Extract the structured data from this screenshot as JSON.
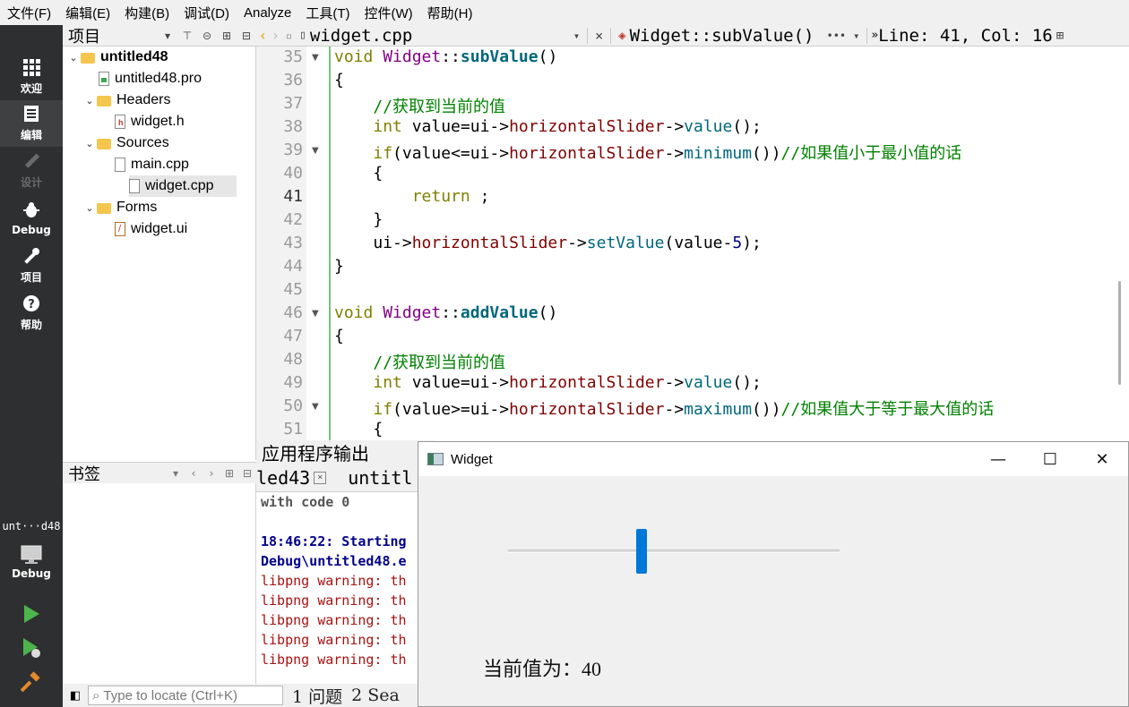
{
  "menubar": {
    "items": [
      "文件(F)",
      "编辑(E)",
      "构建(B)",
      "调试(D)",
      "Analyze",
      "工具(T)",
      "控件(W)",
      "帮助(H)"
    ]
  },
  "modes": [
    {
      "label": "欢迎",
      "icon": "grid-icon",
      "state": "normal"
    },
    {
      "label": "编辑",
      "icon": "document-icon",
      "state": "active"
    },
    {
      "label": "设计",
      "icon": "pencil-icon",
      "state": "disabled"
    },
    {
      "label": "Debug",
      "icon": "bug-icon",
      "state": "normal"
    },
    {
      "label": "项目",
      "icon": "wrench-icon",
      "state": "normal"
    },
    {
      "label": "帮助",
      "icon": "question-icon",
      "state": "normal"
    }
  ],
  "kit": {
    "name": "unt···d48",
    "mode_label": "Debug"
  },
  "project_panel": {
    "title": "项目",
    "tree": [
      {
        "label": "untitled48",
        "type": "project",
        "expanded": true,
        "level": 0,
        "bold": true
      },
      {
        "label": "untitled48.pro",
        "type": "pro",
        "level": 1
      },
      {
        "label": "Headers",
        "type": "folder",
        "expanded": true,
        "level": 1
      },
      {
        "label": "widget.h",
        "type": "h",
        "level": 2
      },
      {
        "label": "Sources",
        "type": "folder",
        "expanded": true,
        "level": 1
      },
      {
        "label": "main.cpp",
        "type": "cpp",
        "level": 2
      },
      {
        "label": "widget.cpp",
        "type": "cpp",
        "level": 2,
        "selected": true
      },
      {
        "label": "Forms",
        "type": "folder",
        "expanded": true,
        "level": 1
      },
      {
        "label": "widget.ui",
        "type": "ui",
        "level": 2
      }
    ]
  },
  "bookmarks_panel": {
    "title": "书签"
  },
  "editor_toolbar": {
    "file_name": "widget.cpp",
    "close_glyph": "×",
    "symbol": "Widget::subValue()",
    "more": "•••",
    "position": "Line: 41, Col: 16"
  },
  "editor": {
    "current_line": 41,
    "lines": [
      {
        "n": 35,
        "fold": true,
        "code": [
          [
            "kw",
            "void "
          ],
          [
            "cls",
            "Widget"
          ],
          [
            "",
            "::"
          ],
          [
            "fn",
            "subValue"
          ],
          [
            "",
            "()"
          ]
        ]
      },
      {
        "n": 36,
        "code": [
          [
            "",
            "{"
          ]
        ]
      },
      {
        "n": 37,
        "code": [
          [
            "",
            "    "
          ],
          [
            "cm",
            "//获取到当前的值"
          ]
        ]
      },
      {
        "n": 38,
        "code": [
          [
            "",
            "    "
          ],
          [
            "kw",
            "int"
          ],
          [
            "",
            " value=ui->"
          ],
          [
            "mem",
            "horizontalSlider"
          ],
          [
            "",
            "->"
          ],
          [
            "call",
            "value"
          ],
          [
            "",
            "();"
          ]
        ]
      },
      {
        "n": 39,
        "fold": true,
        "code": [
          [
            "",
            "    "
          ],
          [
            "kw",
            "if"
          ],
          [
            "",
            "(value<=ui->"
          ],
          [
            "mem",
            "horizontalSlider"
          ],
          [
            "",
            "->"
          ],
          [
            "call",
            "minimum"
          ],
          [
            "",
            "())"
          ],
          [
            "cm",
            "//如果值小于最小值的话"
          ]
        ]
      },
      {
        "n": 40,
        "code": [
          [
            "",
            "    {"
          ]
        ]
      },
      {
        "n": 41,
        "code": [
          [
            "",
            "        "
          ],
          [
            "kw",
            "return"
          ],
          [
            "",
            " ;"
          ]
        ]
      },
      {
        "n": 42,
        "code": [
          [
            "",
            "    }"
          ]
        ]
      },
      {
        "n": 43,
        "code": [
          [
            "",
            "    ui->"
          ],
          [
            "mem",
            "horizontalSlider"
          ],
          [
            "",
            "->"
          ],
          [
            "call",
            "setValue"
          ],
          [
            "",
            "(value-"
          ],
          [
            "num",
            "5"
          ],
          [
            "",
            ");"
          ]
        ]
      },
      {
        "n": 44,
        "code": [
          [
            "",
            "}"
          ]
        ]
      },
      {
        "n": 45,
        "code": []
      },
      {
        "n": 46,
        "fold": true,
        "code": [
          [
            "kw",
            "void "
          ],
          [
            "cls",
            "Widget"
          ],
          [
            "",
            "::"
          ],
          [
            "fn",
            "addValue"
          ],
          [
            "",
            "()"
          ]
        ]
      },
      {
        "n": 47,
        "code": [
          [
            "",
            "{"
          ]
        ]
      },
      {
        "n": 48,
        "code": [
          [
            "",
            "    "
          ],
          [
            "cm",
            "//获取到当前的值"
          ]
        ]
      },
      {
        "n": 49,
        "code": [
          [
            "",
            "    "
          ],
          [
            "kw",
            "int"
          ],
          [
            "",
            " value=ui->"
          ],
          [
            "mem",
            "horizontalSlider"
          ],
          [
            "",
            "->"
          ],
          [
            "call",
            "value"
          ],
          [
            "",
            "();"
          ]
        ]
      },
      {
        "n": 50,
        "fold": true,
        "code": [
          [
            "",
            "    "
          ],
          [
            "kw",
            "if"
          ],
          [
            "",
            "(value>=ui->"
          ],
          [
            "mem",
            "horizontalSlider"
          ],
          [
            "",
            "->"
          ],
          [
            "call",
            "maximum"
          ],
          [
            "",
            "())"
          ],
          [
            "cm",
            "//如果值大于等于最大值的话"
          ]
        ]
      },
      {
        "n": 51,
        "code": [
          [
            "",
            "    {"
          ]
        ]
      }
    ]
  },
  "output_panel": {
    "title": "应用程序输出",
    "tabs": [
      {
        "label": "led43"
      },
      {
        "label": "untitl"
      }
    ],
    "lines": [
      {
        "text": "with code 0",
        "style": "gray"
      },
      {
        "text": "",
        "style": "gray"
      },
      {
        "text": "18:46:22: Starting",
        "style": "blue"
      },
      {
        "text": "Debug\\untitled48.e",
        "style": "blue"
      },
      {
        "text": "libpng warning: th",
        "style": "red"
      },
      {
        "text": "libpng warning: th",
        "style": "red"
      },
      {
        "text": "libpng warning: th",
        "style": "red"
      },
      {
        "text": "libpng warning: th",
        "style": "red"
      },
      {
        "text": "libpng warning: th",
        "style": "red"
      }
    ]
  },
  "statusbar": {
    "locate_placeholder": "Type to locate (Ctrl+K)",
    "items": [
      "1 问题",
      "2 Sea"
    ]
  },
  "widget_window": {
    "title": "Widget",
    "minimize_glyph": "—",
    "maximize_glyph": "☐",
    "close_glyph": "✕",
    "slider": {
      "value": 40,
      "min": 0,
      "max": 100
    },
    "value_label": "当前值为：40"
  },
  "colors": {
    "accent": "#0078d7",
    "modebar_bg": "#2e2f30",
    "keyword": "#808000",
    "comment": "#008000",
    "member": "#800000"
  }
}
